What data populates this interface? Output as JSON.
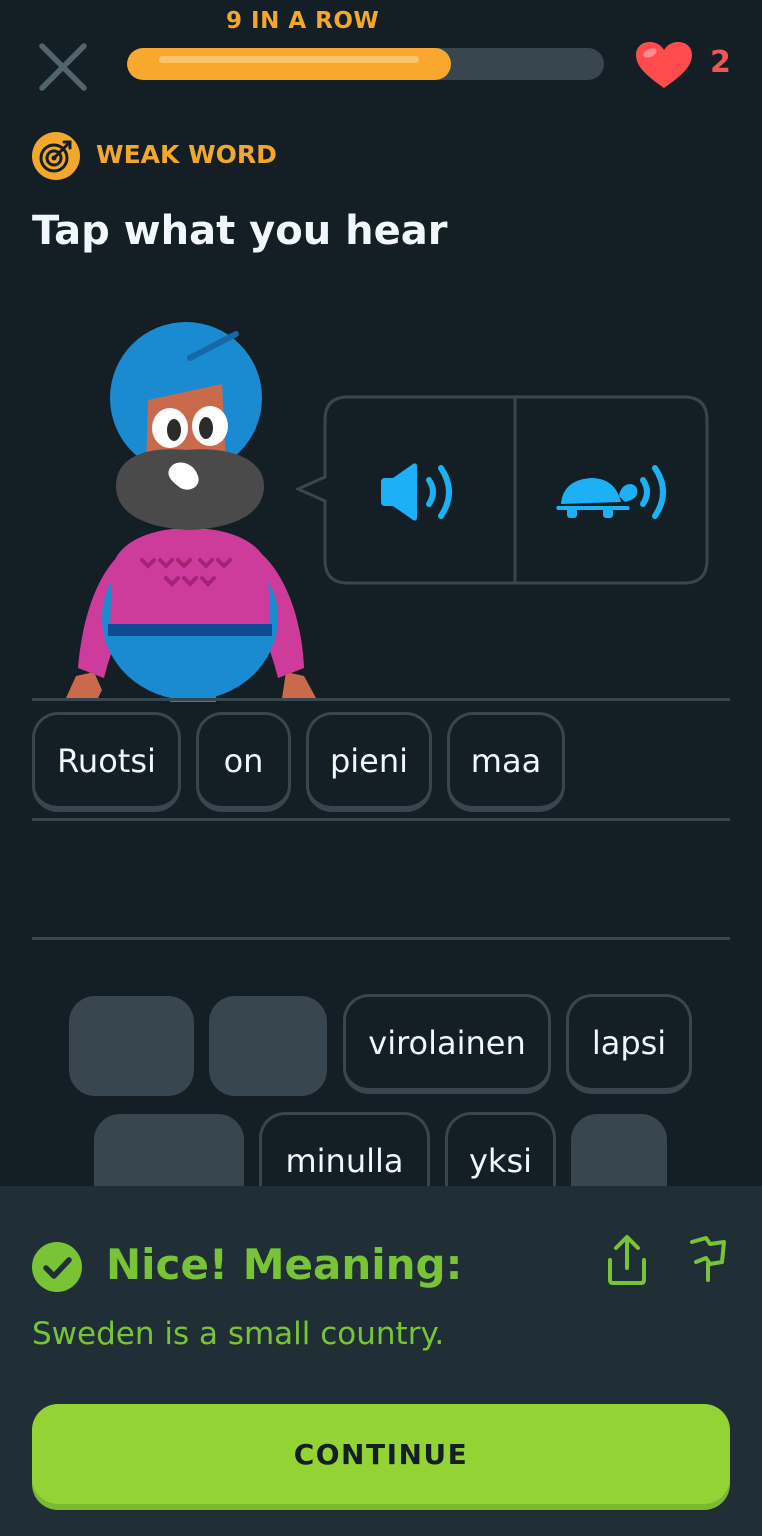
{
  "header": {
    "streak_label": "9 IN A ROW",
    "progress_fraction": 0.68,
    "hearts_count": "2"
  },
  "challenge": {
    "tag_label": "WEAK WORD",
    "instruction": "Tap what you hear"
  },
  "answer_chips": [
    "Ruotsi",
    "on",
    "pieni",
    "maa"
  ],
  "word_bank": {
    "row1": [
      "",
      "",
      "virolainen",
      "lapsi"
    ],
    "row2": [
      "",
      "minulla",
      "yksi",
      ""
    ]
  },
  "feedback": {
    "title": "Nice! Meaning:",
    "translation": "Sweden is a small country.",
    "continue_label": "CONTINUE"
  },
  "icons": {
    "close": "close-icon",
    "heart": "heart-icon",
    "weak_word": "target-icon",
    "audio": "speaker-icon",
    "slow_audio": "turtle-speaker-icon",
    "check": "check-circle-icon",
    "share": "share-icon",
    "report": "flag-icon"
  },
  "colors": {
    "background": "#131f24",
    "accent_orange": "#f4a72d",
    "progress_fill": "#f9a72e",
    "heart_red": "#ee5555",
    "audio_blue": "#1cb0f6",
    "success_green": "#79c336",
    "continue_green": "#93d333",
    "panel_bg": "#202f36"
  }
}
